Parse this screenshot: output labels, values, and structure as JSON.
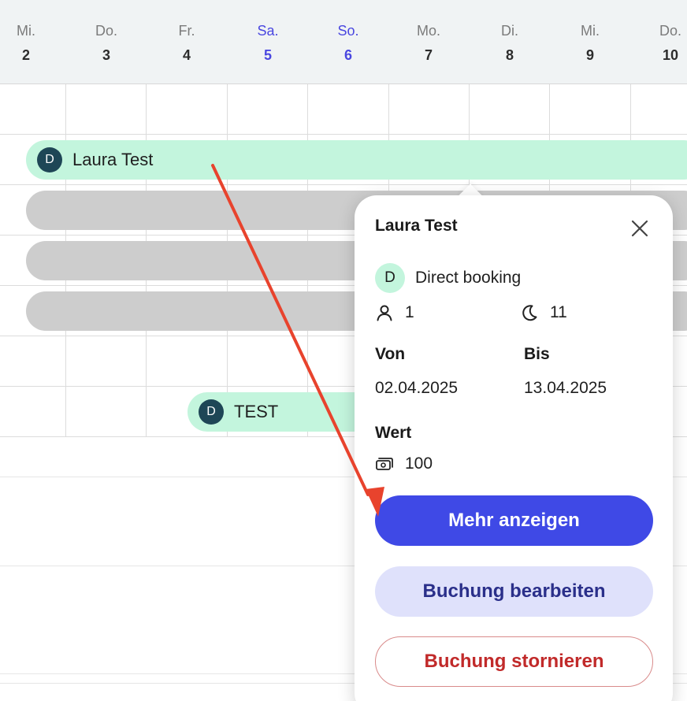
{
  "calendar": {
    "days": [
      {
        "name": "Mi.",
        "num": "2",
        "weekend": false
      },
      {
        "name": "Do.",
        "num": "3",
        "weekend": false
      },
      {
        "name": "Fr.",
        "num": "4",
        "weekend": false
      },
      {
        "name": "Sa.",
        "num": "5",
        "weekend": true
      },
      {
        "name": "So.",
        "num": "6",
        "weekend": true
      },
      {
        "name": "Mo.",
        "num": "7",
        "weekend": false
      },
      {
        "name": "Di.",
        "num": "8",
        "weekend": false
      },
      {
        "name": "Mi.",
        "num": "9",
        "weekend": false
      },
      {
        "name": "Do.",
        "num": "10",
        "weekend": false
      }
    ],
    "weekend_color": "#4a47e0"
  },
  "bookings": [
    {
      "initial": "D",
      "guest": "Laura Test",
      "color": "#c3f5dd"
    },
    {
      "initial": "D",
      "guest": "TEST",
      "color": "#c3f5dd"
    }
  ],
  "popover": {
    "title": "Laura Test",
    "close_icon": "close-icon",
    "source_initial": "D",
    "source_label": "Direct booking",
    "guests_icon": "person-icon",
    "guests": "1",
    "nights_icon": "moon-icon",
    "nights": "11",
    "from_label": "Von",
    "from_value": "02.04.2025",
    "to_label": "Bis",
    "to_value": "13.04.2025",
    "value_label": "Wert",
    "value_icon": "money-icon",
    "value": "100",
    "more_button": "Mehr anzeigen",
    "edit_button": "Buchung bearbeiten",
    "cancel_button": "Buchung stornieren"
  },
  "colors": {
    "primary": "#3f49e6",
    "secondary_bg": "#dfe1fb",
    "danger": "#c12a2a",
    "annotation_arrow": "#e8432d"
  }
}
